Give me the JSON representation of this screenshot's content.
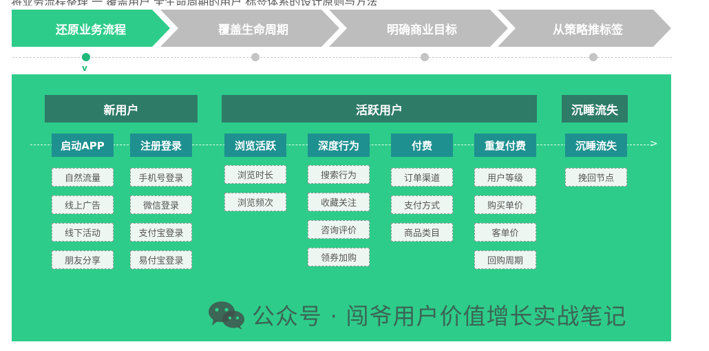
{
  "top_text": "将业务流程整理 一 覆盖用户 全生命周期的用户 标签体系的设计原则与方法",
  "steps": [
    {
      "label": "还原业务流程",
      "state": "active"
    },
    {
      "label": "覆盖生命周期",
      "state": "inactive"
    },
    {
      "label": "明确商业目标",
      "state": "inactive"
    },
    {
      "label": "从策略推标签",
      "state": "inactive"
    }
  ],
  "stages": {
    "new_user": {
      "title": "新用户",
      "groups": [
        {
          "title": "启动APP",
          "items": [
            "自然流量",
            "线上广告",
            "线下活动",
            "朋友分享"
          ]
        },
        {
          "title": "注册登录",
          "items": [
            "手机号登录",
            "微信登录",
            "支付宝登录",
            "易付宝登录"
          ]
        }
      ]
    },
    "active_user": {
      "title": "活跃用户",
      "groups": [
        {
          "title": "浏览活跃",
          "items": [
            "浏览时长",
            "浏览频次"
          ]
        },
        {
          "title": "深度行为",
          "items": [
            "搜索行为",
            "收藏关注",
            "咨询评价",
            "领券加购"
          ]
        },
        {
          "title": "付费",
          "items": [
            "订单渠道",
            "支付方式",
            "商品类目"
          ]
        },
        {
          "title": "重复付费",
          "items": [
            "用户等级",
            "购买单价",
            "客单价",
            "回购周期"
          ]
        }
      ]
    },
    "dormant": {
      "title": "沉睡流失",
      "groups": [
        {
          "title": "沉睡流失",
          "items": [
            "挽回节点"
          ]
        }
      ]
    }
  },
  "watermark": "公众号 · 闯爷用户价值增长实战笔记",
  "colors": {
    "accent": "#2ecc8a",
    "inactive_step": "#bdbdbd",
    "header": "#2e7b68",
    "subheader": "#1e9090",
    "item_bg": "#eef6f2"
  }
}
